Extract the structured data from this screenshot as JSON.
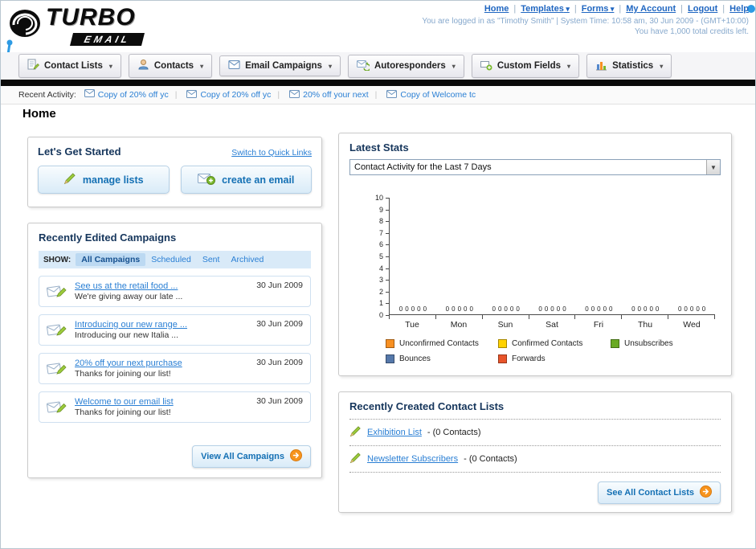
{
  "header": {
    "logo_title": "TURBO",
    "logo_subtitle": "EMAIL",
    "top_links": [
      {
        "label": "Home",
        "dropdown": false
      },
      {
        "label": "Templates",
        "dropdown": true
      },
      {
        "label": "Forms",
        "dropdown": true
      },
      {
        "label": "My Account",
        "dropdown": false
      },
      {
        "label": "Logout",
        "dropdown": false
      },
      {
        "label": "Help",
        "dropdown": false
      }
    ],
    "login_info": "You are logged in as \"Timothy Smith\" | System Time: 10:58 am, 30 Jun 2009 - (GMT+10:00)",
    "credits_info": "You have 1,000 total credits left."
  },
  "nav": {
    "tabs": [
      {
        "label": "Contact Lists",
        "icon": "contact-lists-icon"
      },
      {
        "label": "Contacts",
        "icon": "contacts-icon"
      },
      {
        "label": "Email Campaigns",
        "icon": "email-campaigns-icon"
      },
      {
        "label": "Autoresponders",
        "icon": "autoresponders-icon"
      },
      {
        "label": "Custom Fields",
        "icon": "custom-fields-icon"
      },
      {
        "label": "Statistics",
        "icon": "statistics-icon"
      }
    ]
  },
  "recent_activity": {
    "label": "Recent Activity:",
    "items": [
      "Copy of 20% off yc",
      "Copy of 20% off yc",
      "20% off your next",
      "Copy of Welcome tc"
    ]
  },
  "page_title": "Home",
  "get_started": {
    "title": "Let's Get Started",
    "switch_link": "Switch to Quick Links",
    "manage_lists_label": "manage lists",
    "create_email_label": "create an email"
  },
  "campaigns": {
    "title": "Recently Edited Campaigns",
    "show_label": "SHOW:",
    "filters": [
      {
        "label": "All Campaigns",
        "selected": true
      },
      {
        "label": "Scheduled",
        "selected": false
      },
      {
        "label": "Sent",
        "selected": false
      },
      {
        "label": "Archived",
        "selected": false
      }
    ],
    "items": [
      {
        "title": "See us at the retail food ...",
        "subtitle": "We're giving away our late ...",
        "date": "30 Jun 2009"
      },
      {
        "title": "Introducing our new range ...",
        "subtitle": "Introducing our new Italia ...",
        "date": "30 Jun 2009"
      },
      {
        "title": "20% off your next purchase",
        "subtitle": "Thanks for joining our list!",
        "date": "30 Jun 2009"
      },
      {
        "title": "Welcome to our email list",
        "subtitle": "Thanks for joining our list!",
        "date": "30 Jun 2009"
      }
    ],
    "view_all_label": "View All Campaigns"
  },
  "stats": {
    "title": "Latest Stats",
    "period_selected": "Contact Activity for the Last 7 Days"
  },
  "chart_data": {
    "type": "bar",
    "title": "Contact Activity for the Last 7 Days",
    "categories": [
      "Tue",
      "Mon",
      "Sun",
      "Sat",
      "Fri",
      "Thu",
      "Wed"
    ],
    "series": [
      {
        "name": "Unconfirmed Contacts",
        "color": "#f79022",
        "values": [
          0,
          0,
          0,
          0,
          0,
          0,
          0
        ]
      },
      {
        "name": "Confirmed Contacts",
        "color": "#ffd200",
        "values": [
          0,
          0,
          0,
          0,
          0,
          0,
          0
        ]
      },
      {
        "name": "Unsubscribes",
        "color": "#69aa23",
        "values": [
          0,
          0,
          0,
          0,
          0,
          0,
          0
        ]
      },
      {
        "name": "Bounces",
        "color": "#5578aa",
        "values": [
          0,
          0,
          0,
          0,
          0,
          0,
          0
        ]
      },
      {
        "name": "Forwards",
        "color": "#e8542a",
        "values": [
          0,
          0,
          0,
          0,
          0,
          0,
          0
        ]
      }
    ],
    "ylim": [
      0,
      10
    ],
    "yticks": [
      10,
      9,
      8,
      7,
      6,
      5,
      4,
      3,
      2,
      1,
      0
    ],
    "show_value_labels": true,
    "legend_position": "bottom",
    "grid": false
  },
  "contact_lists": {
    "title": "Recently Created Contact Lists",
    "items": [
      {
        "name": "Exhibition List",
        "detail": "- (0 Contacts)"
      },
      {
        "name": "Newsletter Subscribers",
        "detail": "- (0 Contacts)"
      }
    ],
    "see_all_label": "See All Contact Lists"
  }
}
